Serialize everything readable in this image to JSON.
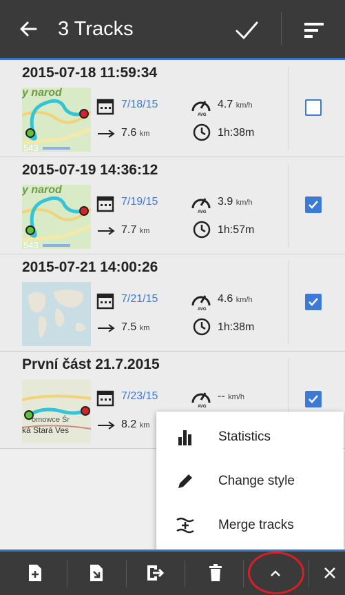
{
  "header": {
    "title": "3 Tracks"
  },
  "tracks": [
    {
      "name": "2015-07-18 11:59:34",
      "date": "7/18/15",
      "distance": "7.6",
      "distance_unit": "km",
      "speed": "4.7",
      "speed_unit": "km/h",
      "duration": "1h:38m",
      "checked": false,
      "thumb": "map-route"
    },
    {
      "name": "2015-07-19 14:36:12",
      "date": "7/19/15",
      "distance": "7.7",
      "distance_unit": "km",
      "speed": "3.9",
      "speed_unit": "km/h",
      "duration": "1h:57m",
      "checked": true,
      "thumb": "map-route"
    },
    {
      "name": "2015-07-21 14:00:26",
      "date": "7/21/15",
      "distance": "7.5",
      "distance_unit": "km",
      "speed": "4.6",
      "speed_unit": "km/h",
      "duration": "1h:38m",
      "checked": true,
      "thumb": "world-map"
    },
    {
      "name": "První část 21.7.2015",
      "date": "7/23/15",
      "distance": "8.2",
      "distance_unit": "km",
      "speed": "--",
      "speed_unit": "km/h",
      "duration": "",
      "checked": true,
      "thumb": "map-village"
    }
  ],
  "thumb_labels": {
    "map_text": "y narod",
    "road_number": "543",
    "village_1": "omowce Śr",
    "village_2": "ká Stará Ves"
  },
  "menu": [
    {
      "label": "Statistics",
      "icon": "bar-chart-icon"
    },
    {
      "label": "Change style",
      "icon": "pencil-icon"
    },
    {
      "label": "Merge tracks",
      "icon": "merge-tracks-icon"
    }
  ],
  "bottom": [
    "add-file-icon",
    "import-icon",
    "export-icon",
    "delete-icon",
    "chevron-up-icon",
    "close-icon"
  ],
  "colors": {
    "accent": "#3d7ad6",
    "bar": "#3a3a3a",
    "highlight": "#d81f26"
  }
}
